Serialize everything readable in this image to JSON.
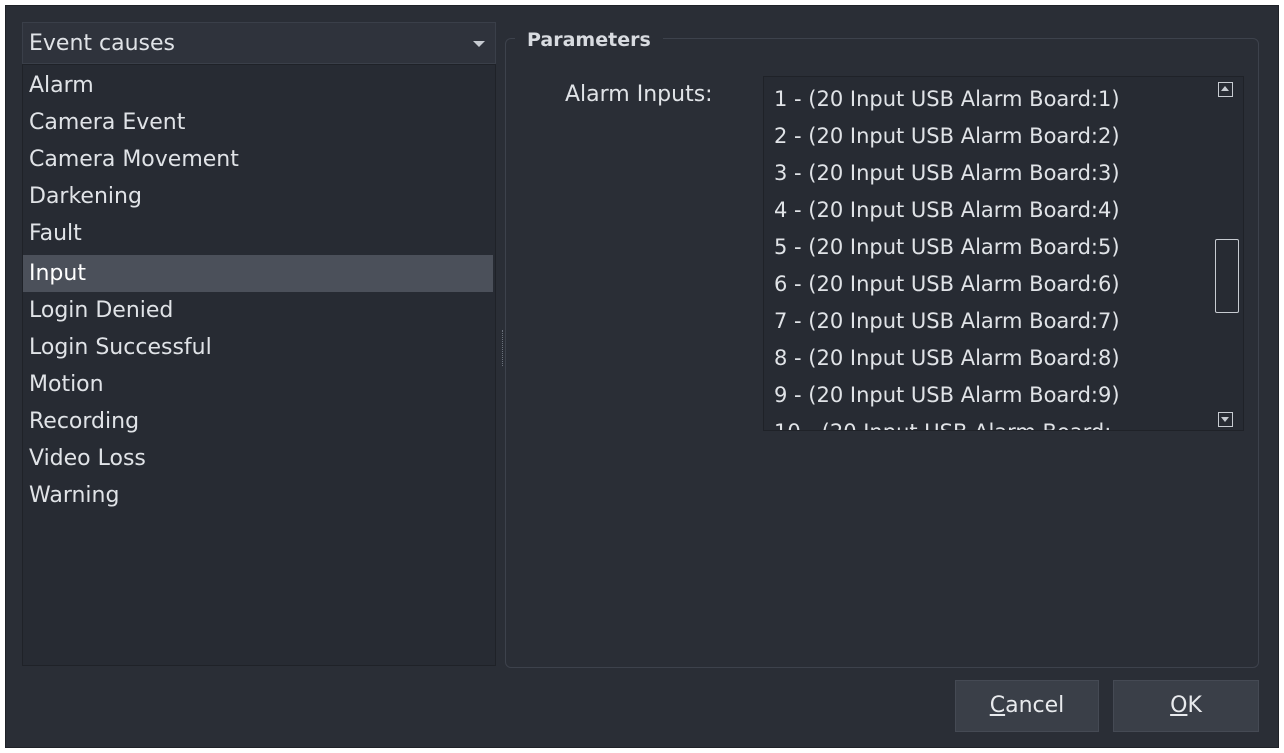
{
  "event_causes": {
    "selected_label": "Event causes",
    "items": [
      {
        "label": "Alarm"
      },
      {
        "label": "Camera Event"
      },
      {
        "label": "Camera Movement"
      },
      {
        "label": "Darkening"
      },
      {
        "label": "Fault"
      },
      {
        "label": "Input",
        "selected": true
      },
      {
        "label": "Login Denied"
      },
      {
        "label": "Login Successful"
      },
      {
        "label": "Motion"
      },
      {
        "label": "Recording"
      },
      {
        "label": "Video Loss"
      },
      {
        "label": "Warning"
      }
    ]
  },
  "parameters": {
    "title": "Parameters",
    "alarm_inputs_label": "Alarm Inputs:",
    "alarm_inputs": [
      "1 - (20 Input USB Alarm Board:1)",
      "2 - (20 Input USB Alarm Board:2)",
      "3 - (20 Input USB Alarm Board:3)",
      "4 - (20 Input USB Alarm Board:4)",
      "5 - (20 Input USB Alarm Board:5)",
      "6 - (20 Input USB Alarm Board:6)",
      "7 - (20 Input USB Alarm Board:7)",
      "8 - (20 Input USB Alarm Board:8)",
      "9 - (20 Input USB Alarm Board:9)",
      "10 - (20 Input USB Alarm Board:"
    ]
  },
  "buttons": {
    "cancel_mnemonic": "C",
    "cancel_rest": "ancel",
    "ok_mnemonic": "O",
    "ok_rest": "K"
  },
  "colors": {
    "background": "#2a2e36",
    "selected": "#4b505a",
    "text": "#e0e3e7"
  }
}
